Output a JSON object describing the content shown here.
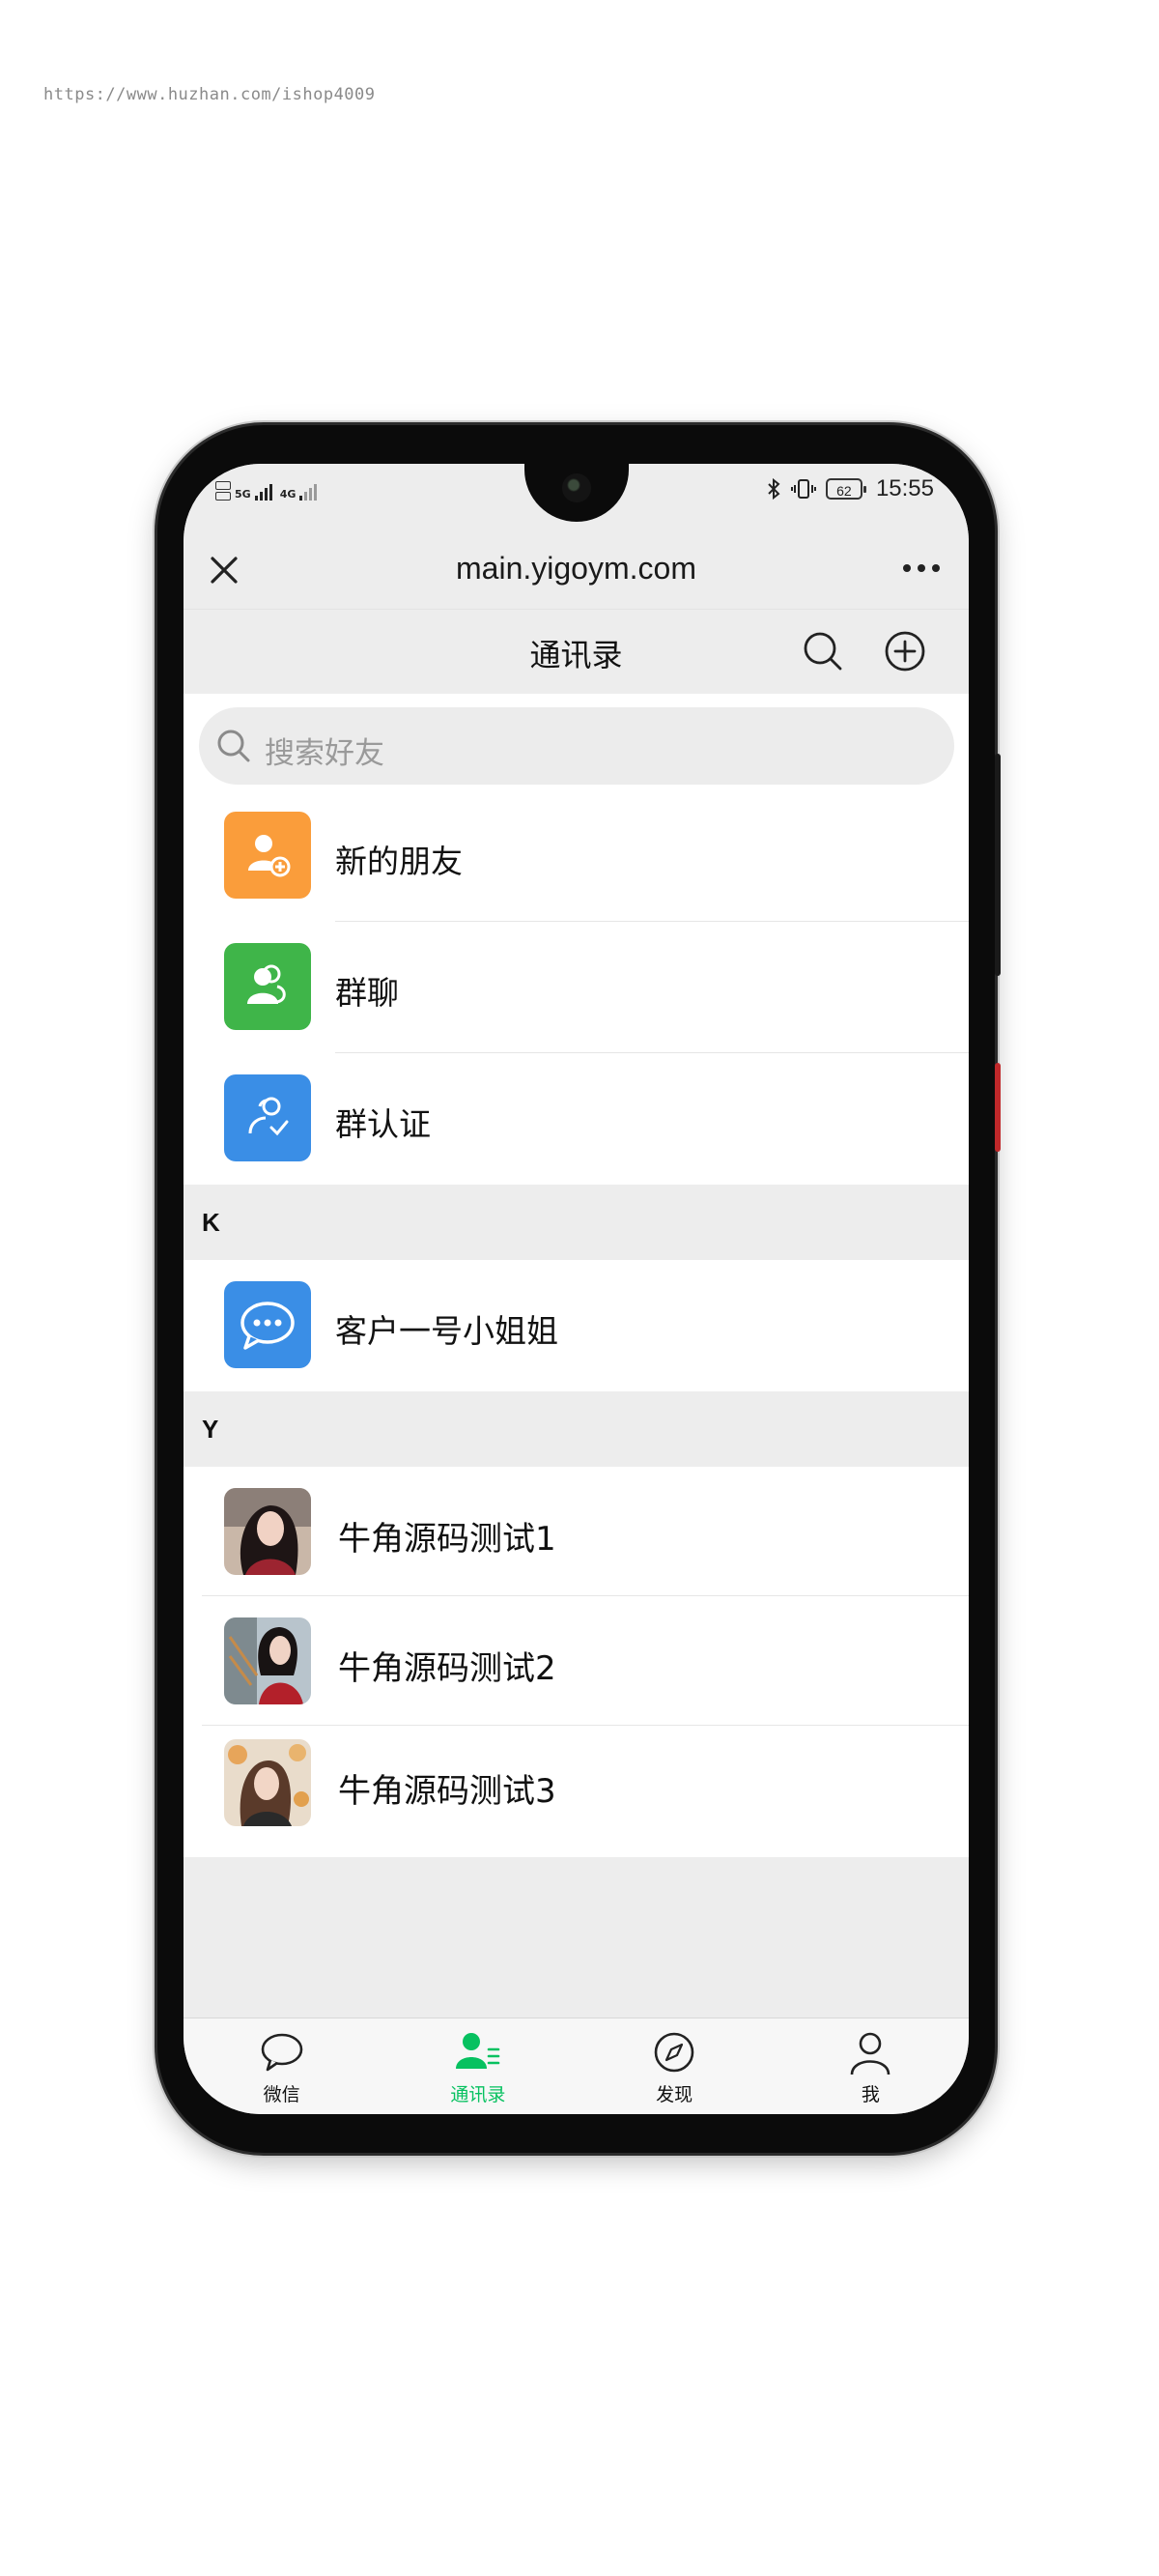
{
  "watermark": "https://www.huzhan.com/ishop4009",
  "status_bar": {
    "network_a": "5G",
    "network_b": "4G",
    "battery": "62",
    "time": "15:55",
    "icons": [
      "bluetooth-icon",
      "vibrate-icon",
      "battery-icon"
    ]
  },
  "browser": {
    "url": "main.yigoym.com",
    "close_icon": "close-icon",
    "more_icon": "more-icon"
  },
  "header": {
    "title": "通讯录",
    "search_icon": "search-icon",
    "add_icon": "add-circle-icon"
  },
  "search": {
    "placeholder": "搜索好友"
  },
  "functions": [
    {
      "label": "新的朋友",
      "icon": "add-friend-icon",
      "color": "#fa9d3b"
    },
    {
      "label": "群聊",
      "icon": "group-chat-icon",
      "color": "#3fb549"
    },
    {
      "label": "群认证",
      "icon": "group-verify-icon",
      "color": "#3a8ee6"
    }
  ],
  "sections": [
    {
      "letter": "K",
      "contacts": [
        {
          "name": "客户一号小姐姐",
          "icon": "chat-bubble-icon",
          "color": "#3a8ee6"
        }
      ]
    },
    {
      "letter": "Y",
      "contacts": [
        {
          "name": "牛角源码测试1",
          "avatar": "photo-avatar"
        },
        {
          "name": "牛角源码测试2",
          "avatar": "photo-avatar"
        },
        {
          "name": "牛角源码测试3",
          "avatar": "photo-avatar"
        }
      ]
    }
  ],
  "tabs": [
    {
      "label": "微信",
      "icon": "chat-icon",
      "active": false
    },
    {
      "label": "通讯录",
      "icon": "contacts-icon",
      "active": true
    },
    {
      "label": "发现",
      "icon": "compass-icon",
      "active": false
    },
    {
      "label": "我",
      "icon": "profile-icon",
      "active": false
    }
  ],
  "colors": {
    "accent": "#07c160",
    "background": "#ededed"
  }
}
